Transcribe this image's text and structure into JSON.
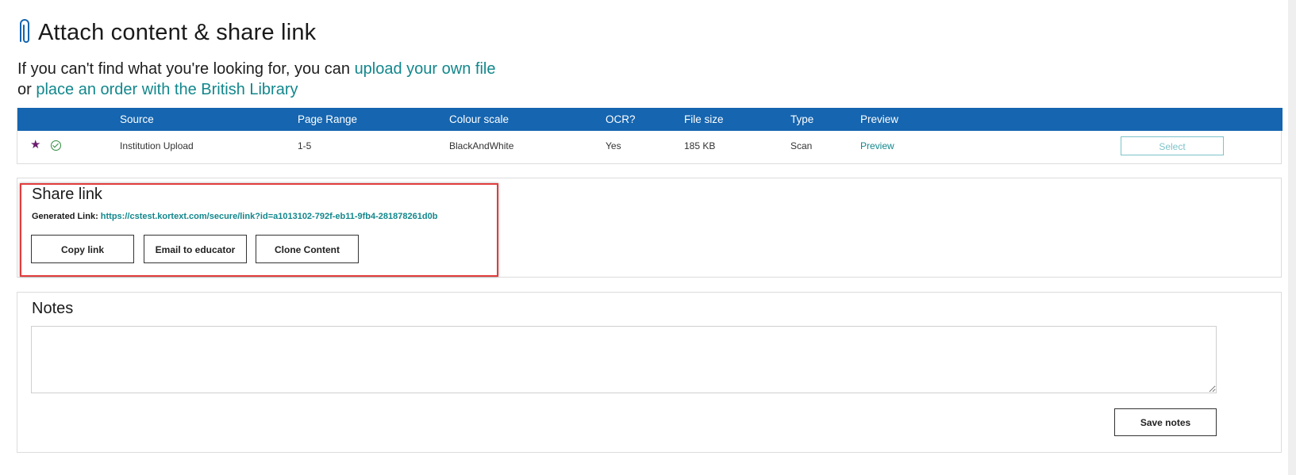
{
  "header": {
    "title": "Attach content & share link",
    "icon": "paperclip-icon"
  },
  "intro": {
    "text_1": "If you can't find what you're looking for, you can ",
    "link_upload": "upload your own file",
    "text_2": "or ",
    "link_order": "place an order with the British Library"
  },
  "table": {
    "columns": [
      "Source",
      "Page Range",
      "Colour scale",
      "OCR?",
      "File size",
      "Type",
      "Preview"
    ],
    "rows": [
      {
        "icons": [
          "star-icon",
          "check-circle-icon"
        ],
        "source": "Institution Upload",
        "page_range": "1-5",
        "colour_scale": "BlackAndWhite",
        "ocr": "Yes",
        "file_size": "185 KB",
        "type": "Scan",
        "preview": "Preview",
        "action": "Select"
      }
    ]
  },
  "share": {
    "title": "Share link",
    "generated_label": "Generated Link: ",
    "url": "https://cstest.kortext.com/secure/link?id=a1013102-792f-eb11-9fb4-281878261d0b",
    "buttons": {
      "copy": "Copy link",
      "email": "Email to educator",
      "clone": "Clone Content"
    }
  },
  "notes": {
    "title": "Notes",
    "value": "",
    "save_label": "Save notes"
  },
  "colors": {
    "table_header": "#1565b0",
    "link": "#12878c",
    "highlight": "#e23c3c",
    "star": "#6a1b6e",
    "check": "#2e8b3e"
  }
}
